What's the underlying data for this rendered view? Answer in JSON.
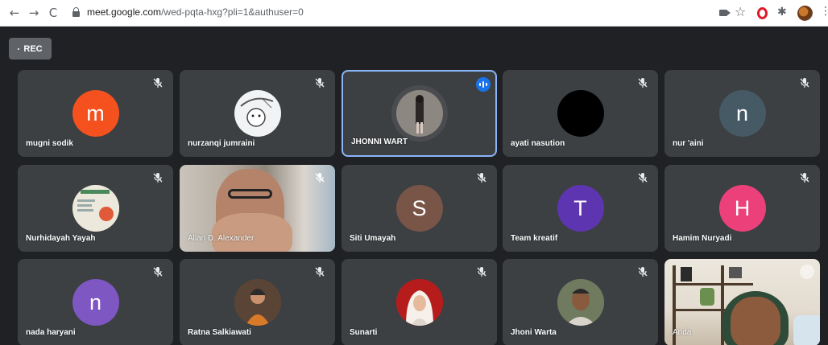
{
  "browser": {
    "back_icon": "arrow-left-icon",
    "forward_icon": "arrow-right-icon",
    "reload_icon": "reload-icon",
    "url_host": "meet.google.com",
    "url_path": "/wed-pqta-hxg?pli=1&authuser=0"
  },
  "meeting": {
    "rec_label": "REC",
    "participants": [
      {
        "name": "mugni sodik",
        "avatar_letter": "m",
        "avatar_color": "#f4511e",
        "muted": true
      },
      {
        "name": "nurzanqi jumraini",
        "avatar_color": "#f1f3f4",
        "muted": true
      },
      {
        "name": "JHONNI WART",
        "avatar_color": "#5f6368",
        "speaking": true,
        "active": true
      },
      {
        "name": "ayati nasution",
        "avatar_color": "#000000",
        "muted": true
      },
      {
        "name": "nur 'aini",
        "avatar_letter": "n",
        "avatar_color": "#455a64",
        "muted": true
      },
      {
        "name": "Nurhidayah Yayah",
        "avatar_color": "#e8e4d8",
        "muted": true
      },
      {
        "name": "Allan D. Alexander",
        "video": true,
        "muted": true
      },
      {
        "name": "Siti Umayah",
        "avatar_letter": "S",
        "avatar_color": "#795548",
        "muted": true
      },
      {
        "name": "Team kreatif",
        "avatar_letter": "T",
        "avatar_color": "#5e35b1",
        "muted": true
      },
      {
        "name": "Hamim Nuryadi",
        "avatar_letter": "H",
        "avatar_color": "#ec407a",
        "muted": true
      },
      {
        "name": "nada haryani",
        "avatar_letter": "n",
        "avatar_color": "#7e57c2",
        "muted": true
      },
      {
        "name": "Ratna Salkiawati",
        "avatar_color": "#6d4c41",
        "muted": true
      },
      {
        "name": "Sunarti",
        "avatar_color": "#c62828",
        "muted": true
      },
      {
        "name": "Jhoni Warta",
        "avatar_color": "#8d6e63",
        "muted": true
      },
      {
        "name": "Anda",
        "video": true,
        "muted": true
      }
    ]
  }
}
